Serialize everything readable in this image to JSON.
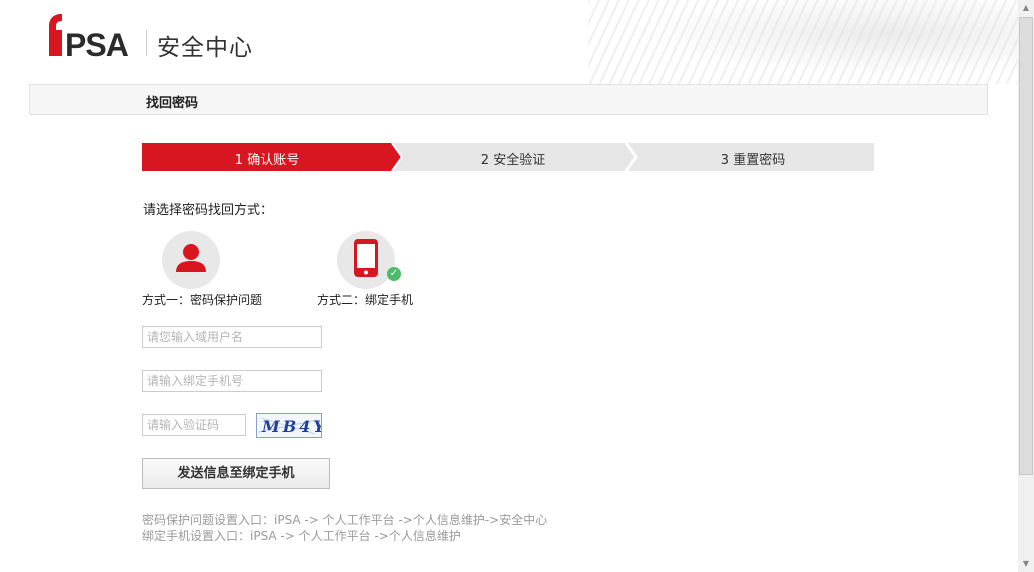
{
  "header": {
    "logo_text": "iPSA",
    "section_title": "安全中心"
  },
  "page_title": "找回密码",
  "steps": [
    {
      "label": "1 确认账号",
      "active": true
    },
    {
      "label": "2 安全验证",
      "active": false
    },
    {
      "label": "3 重置密码",
      "active": false
    }
  ],
  "prompt": "请选择密码找回方式：",
  "methods": [
    {
      "label": "方式一：密码保护问题",
      "icon": "user-icon",
      "selected": false
    },
    {
      "label": "方式二：绑定手机",
      "icon": "mobile-phone-icon",
      "selected": true
    }
  ],
  "form": {
    "username_placeholder": "请您输入域用户名",
    "phone_placeholder": "请输入绑定手机号",
    "captcha_placeholder": "请输入验证码",
    "captcha_text": "MB4Y",
    "submit_label": "发送信息至绑定手机"
  },
  "notes": [
    "密码保护问题设置入口：iPSA -> 个人工作平台 ->个人信息维护->安全中心",
    "绑定手机设置入口：iPSA -> 个人工作平台 ->个人信息维护"
  ],
  "colors": {
    "brand_red": "#d7161f",
    "step_inactive": "#e6e6e6",
    "success_green": "#4cbb6a"
  }
}
